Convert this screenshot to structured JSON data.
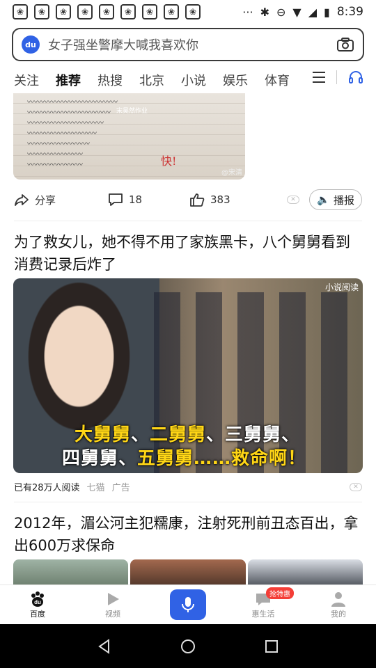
{
  "status": {
    "time": "8:39",
    "dots": "···"
  },
  "search": {
    "query": "女子强坐警摩大喊我喜欢你",
    "logo": "du"
  },
  "tabs": [
    "关注",
    "推荐",
    "热搜",
    "北京",
    "小说",
    "娱乐",
    "体育"
  ],
  "active_tab": "推荐",
  "card1": {
    "image_text": "宋昊然作业",
    "image_watermark": "@宋清",
    "red_text": "快!",
    "share_label": "分享",
    "comment_count": "18",
    "like_count": "383",
    "close_label": "✕",
    "read_label": "播报"
  },
  "card2": {
    "title": "为了救女儿，她不得不用了家族黑卡，八个舅舅看到消费记录后炸了",
    "sticker": "小说阅读",
    "caption1_a": "大舅舅",
    "caption1_b": "、",
    "caption1_c": "二舅舅",
    "caption1_d": "、三舅舅、",
    "caption2_a": "四舅舅、",
    "caption2_b": "五舅舅",
    "caption2_c": "……救命啊！",
    "reads": "已有28万人阅读",
    "source": "七猫",
    "ad_label": "广告"
  },
  "card3": {
    "title": "2012年，湄公河主犯糯康，注射死刑前丑态百出，拿出600万求保命"
  },
  "bottom_nav": [
    {
      "label": "百度",
      "icon": "paw-icon"
    },
    {
      "label": "视频",
      "icon": "play-icon"
    },
    {
      "label": "",
      "icon": "mic-icon"
    },
    {
      "label": "惠生活",
      "icon": "chat-icon",
      "badge": "抢特惠"
    },
    {
      "label": "我的",
      "icon": "user-icon"
    }
  ],
  "colors": {
    "accent": "#3062e5",
    "badge": "#f43e37",
    "caption_yellow": "#ffd616"
  }
}
